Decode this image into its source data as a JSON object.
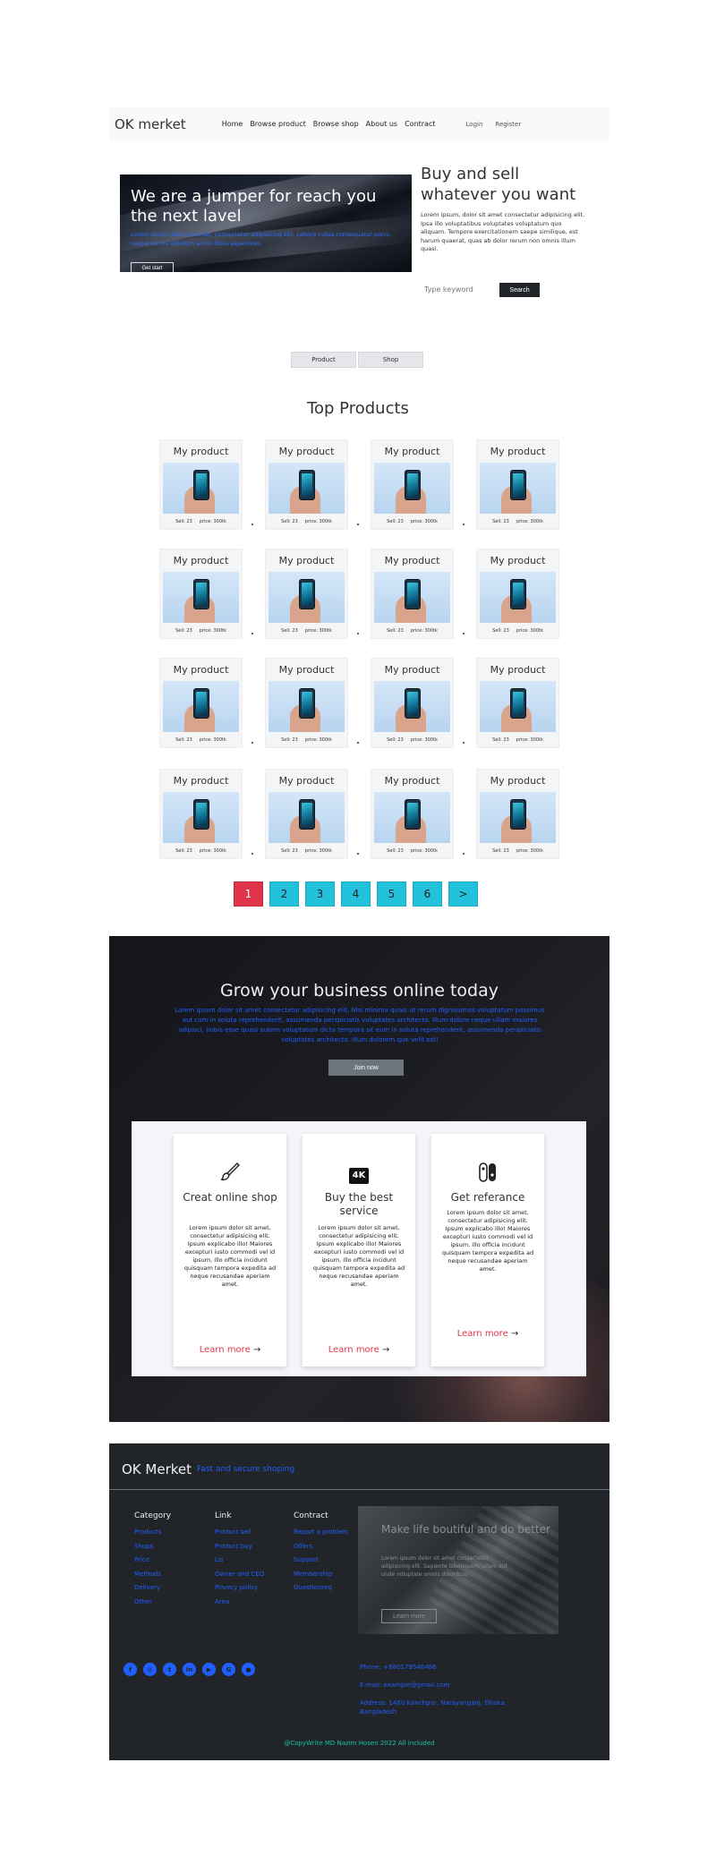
{
  "navbar": {
    "brand": "OK merket",
    "links": [
      "Home",
      "Browse product",
      "Browse shop",
      "About us",
      "Contract"
    ],
    "auth": [
      "Login",
      "Register"
    ]
  },
  "hero": {
    "title": "We are a jumper for reach you the next lavel",
    "text": "Lorem ipsum dolor sit amet, consectetur adipisicing elit. Labore culpa consequatur porro, neque omnis dolorum animi dicta asperiores.",
    "button": "Get start"
  },
  "intro": {
    "title": "Buy and sell whatever you want",
    "text": "Lorem ipsum, dolor sit amet consectetur adipisicing elit. Ipsa illo voluptatibus voluptates voluptatum quo aliquam. Tempore exercitationem saepe similique, est harum quaerat, quas ab dolor rerum non omnis illum quasi.",
    "search_placeholder": "Type keyword",
    "search_button": "Search"
  },
  "tabs": [
    "Product",
    "Shop"
  ],
  "products_title": "Top Products",
  "product_card": {
    "title": "My product",
    "sell": "Sell: 23",
    "price": "price: 300tk"
  },
  "pagination": [
    "1",
    "2",
    "3",
    "4",
    "5",
    "6",
    ">"
  ],
  "banner": {
    "title": "Grow your business online today",
    "text": "Lorem ipsum dolor sit amet consectetur adipisicing elit. Nisi minima quasi ut rerum dignissimos voluptatum possimus aut cum in soluta reprehenderit, assumenda perspiciatis voluptates architecto. Illum dolore neque ullam maiores adipisci, nobis esse quasi autem voluptatum dicta tempora sit eum in soluta reprehenderit, assumenda perspiciatis voluptates architecto. Illum dolorem que velit est!",
    "button": "Join now"
  },
  "features": [
    {
      "icon": "brush-icon",
      "title": "Creat online shop",
      "text": "Lorem ipsum dolor sit amet, consectetur adipisicing elit. Ipsum explicabo illo! Maiores excepturi iusto commodi vel id ipsum, illo officia incidunt quisquam tempora expedita ad neque recusandae aperiam amet.",
      "link": "Learn more"
    },
    {
      "icon": "4k-icon",
      "title": "Buy the best service",
      "text": "Lorem ipsum dolor sit amet, consectetur adipisicing elit. Ipsum explicabo illo! Maiores excepturi iusto commodi vel id ipsum, illo officia incidunt quisquam tempora expedita ad neque recusandae aperiam amet.",
      "link": "Learn more"
    },
    {
      "icon": "switch-icon",
      "title": "Get referance",
      "text": "Lorem ipsum dolor sit amet, consectetur adipisicing elit. Ipsum explicabo illo! Maiores excepturi iusto commodi vel id ipsum, illo officia incidunt quisquam tempora expedita ad neque recusandae aperiam amet.",
      "link": "Learn more"
    }
  ],
  "footer": {
    "brand": "OK Merket",
    "tagline": "Fast and secure shoping",
    "columns": [
      {
        "title": "Category",
        "items": [
          "Products",
          "Shops",
          "Price",
          "Methods",
          "Delivery",
          "Other"
        ]
      },
      {
        "title": "Link",
        "items": [
          "Product sell",
          "Product buy",
          "Lis",
          "Owner and CEO",
          "Privecy policy",
          "Area"
        ]
      },
      {
        "title": "Contract",
        "items": [
          "Report a problem",
          "Offers",
          "Support",
          "Membership",
          "Questionreq"
        ]
      }
    ],
    "promo": {
      "title": "Make life boutiful and do better",
      "text": "Lorem ipsum dolor sit amet consectetur adipisicing elit. Sapiente laboriosam, ullam aut unde voluptate omnis doloribus!",
      "button": "Learn more"
    },
    "social_icons": [
      "facebook-icon",
      "instagram-icon",
      "twitter-icon",
      "linkedin-icon",
      "youtube-icon",
      "google-icon",
      "github-icon"
    ],
    "contact": {
      "phone": "Phone: +880179546486",
      "email": "E-mail: example@gmail.com",
      "address": "Address: 1460 Kanchpur, Narayanganj, Dhaka, Bangladesh"
    },
    "copyright": "@CopyWrite MD Nazim Hosen 2022 All included"
  }
}
